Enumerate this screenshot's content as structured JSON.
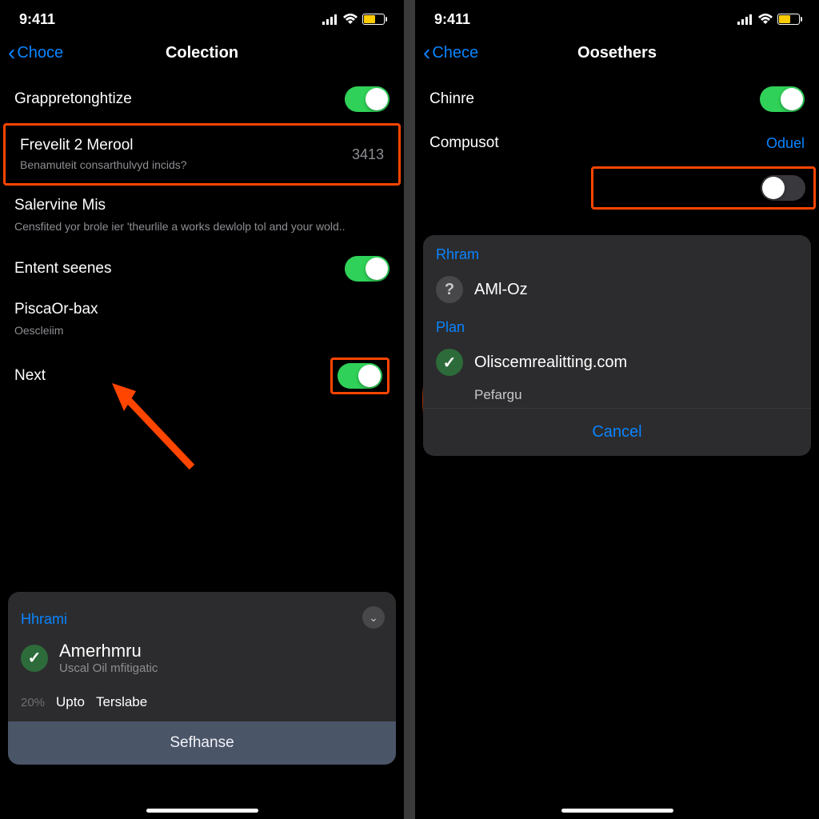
{
  "left": {
    "status": {
      "time": "9:411"
    },
    "nav": {
      "back": "Choce",
      "title": "Colection"
    },
    "rows": {
      "r1": {
        "label": "Grappretonghtize"
      },
      "r2": {
        "label": "Frevelit 2 Merool",
        "sub": "Benamuteit consarthulvyd incids?",
        "value": "3413"
      },
      "r3": {
        "label": "Salervine Mis",
        "sub": "Censfited yor brole ier 'theurlile a works dewlolp tol and your wold.."
      },
      "r4": {
        "label": "Entent seenes"
      },
      "r5": {
        "label": "PiscaOr-bax",
        "sub": "Oescleiim"
      },
      "r6": {
        "label": "Next"
      }
    },
    "sheet": {
      "header": "Hhrami",
      "item": {
        "title": "Amerhmru",
        "sub": "Uscal Oil mfitigatic"
      },
      "bottom": {
        "percent": "20%",
        "label": "Upto",
        "label2": "Terslabe"
      },
      "action": "Sefhanse"
    }
  },
  "right": {
    "status": {
      "time": "9:411"
    },
    "nav": {
      "back": "Chece",
      "title": "Oosethers"
    },
    "rows": {
      "r1": {
        "label": "Chinre"
      },
      "r2": {
        "label": "Compusot",
        "value": "Oduel"
      }
    },
    "sheet": {
      "h1": "Rhram",
      "item1": "AMl-Oz",
      "h2": "Plan",
      "item2": "Oliscemrealitting.com",
      "item3": "Pefargu",
      "cancel": "Cancel"
    }
  }
}
